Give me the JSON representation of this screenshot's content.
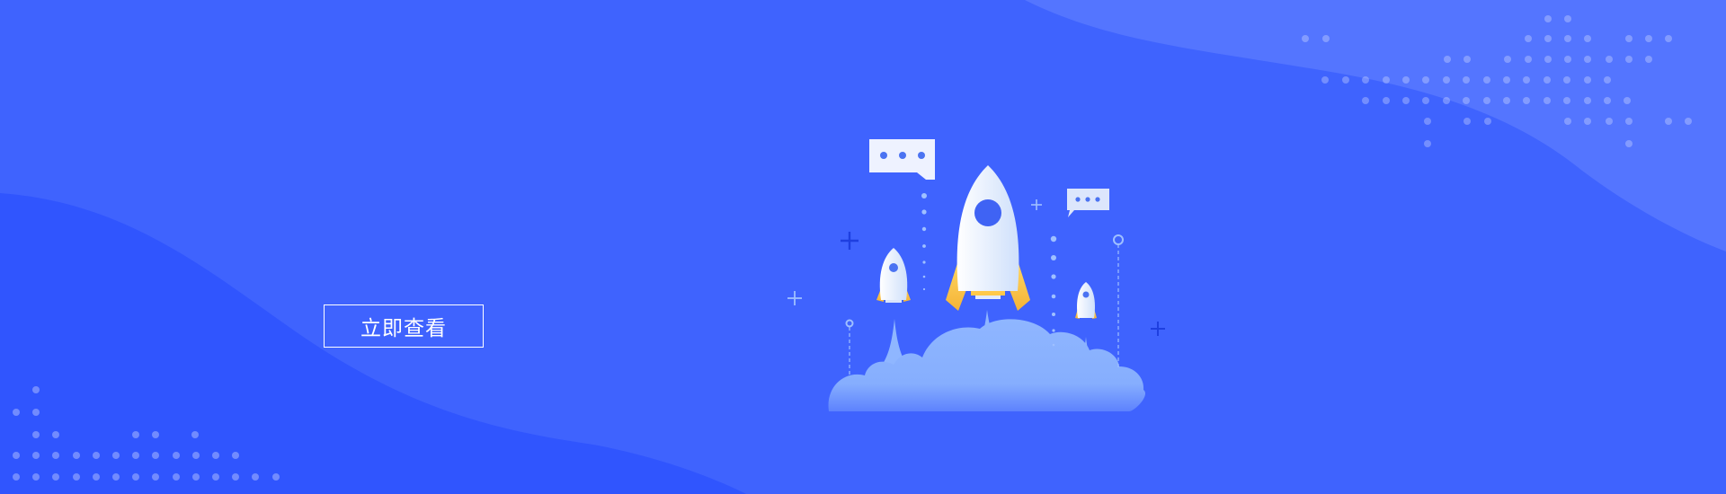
{
  "banner": {
    "cta_label": "立即查看",
    "colors": {
      "background": "#3f63fe",
      "wave_dark": "#3055fe",
      "wave_light": "#5475ff",
      "cloud": "#8fb6ff",
      "rocket_body": "#eef4ff",
      "rocket_fin": "#ffc94a",
      "accent_plus": "#1e3fe0"
    },
    "illustration": {
      "subject": "rocket-launch",
      "rockets": [
        "large-rocket",
        "small-rocket-left",
        "small-rocket-right"
      ],
      "speech_bubbles": [
        "speech-bubble-left",
        "speech-bubble-right"
      ]
    }
  }
}
